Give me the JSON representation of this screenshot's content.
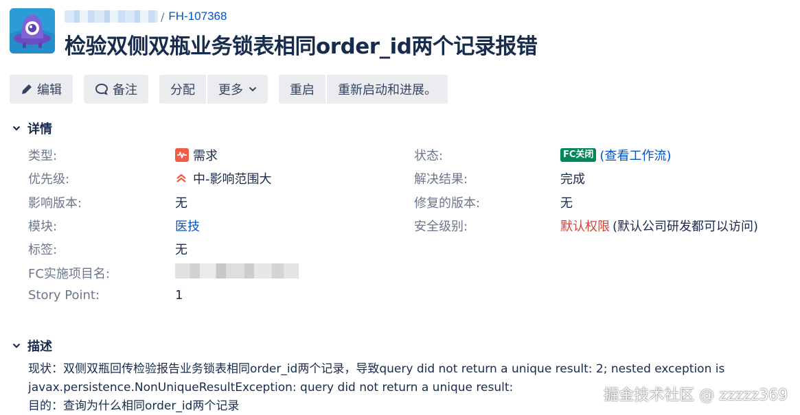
{
  "header": {
    "breadcrumb_key": "FH-107368",
    "breadcrumb_sep": "/",
    "title": "检验双侧双瓶业务锁表相同order_id两个记录报错"
  },
  "toolbar": {
    "edit": "编辑",
    "comment": "备注",
    "assign": "分配",
    "more": "更多",
    "reopen": "重启",
    "restart_progress": "重新启动和进展。"
  },
  "details": {
    "title": "详情",
    "left": [
      {
        "label": "类型:",
        "value": "需求",
        "icon": "requirement-icon"
      },
      {
        "label": "优先级:",
        "value": "中-影响范围大",
        "icon": "priority-major-icon"
      },
      {
        "label": "影响版本:",
        "value": "无"
      },
      {
        "label": "模块:",
        "value": "医技"
      },
      {
        "label": "标签:",
        "value": "无"
      },
      {
        "label": "FC实施项目名:",
        "value": ""
      },
      {
        "label": "Story Point:",
        "value": "1"
      }
    ],
    "right": [
      {
        "label": "状态:",
        "status": "FC关闭",
        "value": "(查看工作流)"
      },
      {
        "label": "解决结果:",
        "value": "完成"
      },
      {
        "label": "修复的版本:",
        "value": "无"
      },
      {
        "label": "安全级别:",
        "value": "默认权限",
        "extra": "(默认公司研发都可以访问)"
      }
    ]
  },
  "description": {
    "title": "描述",
    "lines": [
      "现状：双侧双瓶回传检验报告业务锁表相同order_id两个记录，导致query did not return a unique result: 2; nested exception is",
      "javax.persistence.NonUniqueResultException: query did not return a unique result:",
      "目的：查询为什么相同order_id两个记录"
    ]
  },
  "watermark": "掘金技术社区 @ zzzzz369",
  "colors": {
    "link": "#0052cc",
    "status_lozenge": "#00875a",
    "security_red": "#d04437",
    "button_bg": "#ebecf0"
  }
}
